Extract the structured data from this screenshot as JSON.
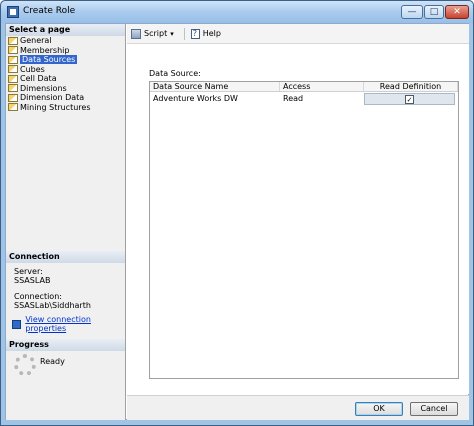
{
  "window": {
    "title": "Create Role",
    "controls": {
      "minimize": "—",
      "maximize": "□",
      "close": "✕"
    }
  },
  "left_pane": {
    "select_page_header": "Select a page",
    "pages": [
      {
        "label": "General",
        "icon": "page-icon"
      },
      {
        "label": "Membership",
        "icon": "page-icon"
      },
      {
        "label": "Data Sources",
        "icon": "page-icon",
        "selected": true
      },
      {
        "label": "Cubes",
        "icon": "page-icon"
      },
      {
        "label": "Cell Data",
        "icon": "page-icon"
      },
      {
        "label": "Dimensions",
        "icon": "page-icon"
      },
      {
        "label": "Dimension Data",
        "icon": "page-icon"
      },
      {
        "label": "Mining Structures",
        "icon": "page-icon"
      }
    ],
    "connection": {
      "header": "Connection",
      "server_label": "Server:",
      "server_value": "SSASLAB",
      "connection_label": "Connection:",
      "connection_value": "SSASLab\\Siddharth",
      "view_link": "View connection properties"
    },
    "progress": {
      "header": "Progress",
      "status": "Ready"
    }
  },
  "toolbar": {
    "script_label": "Script",
    "help_label": "Help",
    "dropdown_glyph": "▾"
  },
  "main": {
    "data_source_label": "Data Source:",
    "table": {
      "columns": [
        "Data Source Name",
        "Access",
        "Read Definition"
      ],
      "rows": [
        {
          "name": "Adventure Works DW",
          "access": "Read",
          "read_definition_checked": true,
          "check_glyph": "✓"
        }
      ]
    }
  },
  "footer": {
    "ok_label": "OK",
    "cancel_label": "Cancel"
  },
  "colors": {
    "title_bar": "#a9cbee",
    "selected_item": "#3366cc",
    "link": "#0033cc"
  }
}
